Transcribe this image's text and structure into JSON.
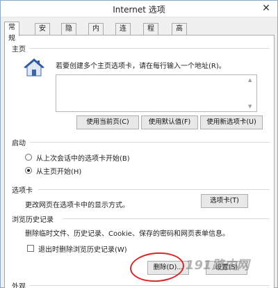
{
  "window": {
    "title": "Internet 选项",
    "close_label": "✕"
  },
  "tabs": [
    {
      "label": "常规",
      "active": true
    },
    {
      "label": "安全"
    },
    {
      "label": "隐私"
    },
    {
      "label": "内容"
    },
    {
      "label": "连接"
    },
    {
      "label": "程序"
    },
    {
      "label": "高级"
    }
  ],
  "home": {
    "section_title": "主页",
    "instruction": "若要创建多个主页选项卡，请在每行输入一个地址(R)。",
    "address_value": "",
    "buttons": {
      "use_current": "使用当前页(C)",
      "use_default": "使用默认值(F)",
      "use_new_tab": "使用新选项卡(U)"
    }
  },
  "startup": {
    "section_title": "启动",
    "options": [
      {
        "label": "从上次会话中的选项卡开始(B)",
        "checked": false
      },
      {
        "label": "从主页开始(H)",
        "checked": true
      }
    ]
  },
  "tabs_section": {
    "section_title": "选项卡",
    "description": "更改网页在选项卡中的显示方式。",
    "button": "选项卡(T)"
  },
  "history": {
    "section_title": "浏览历史记录",
    "description": "删除临时文件、历史记录、Cookie、保存的密码和网页表单信息。",
    "delete_on_exit": {
      "label": "退出时删除浏览历史记录(W)",
      "checked": false
    },
    "buttons": {
      "delete": "删除(D)...",
      "settings": "设置(S)"
    }
  },
  "appearance": {
    "section_title": "外观"
  },
  "watermark": "191路由网",
  "colors": {
    "highlight": "#d62727",
    "house_roof": "#2f5aa0"
  }
}
